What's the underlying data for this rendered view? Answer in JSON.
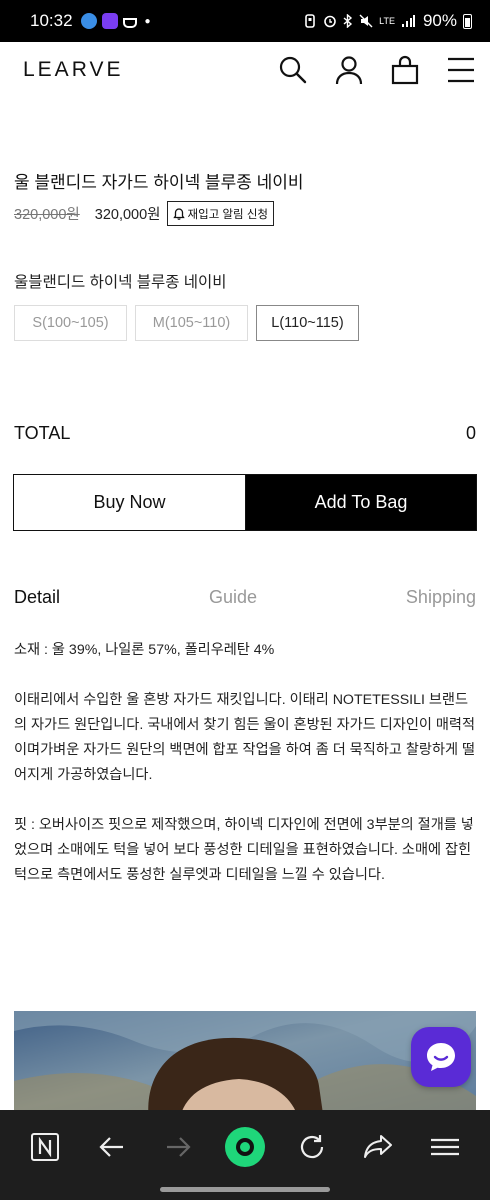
{
  "status_bar": {
    "time": "10:32",
    "network": "LTE",
    "battery": "90%"
  },
  "header": {
    "logo": "LEARVE",
    "icons": [
      "search-icon",
      "user-icon",
      "bag-icon",
      "menu-icon"
    ]
  },
  "product": {
    "title": "울 블랜디드 자가드 하이넥 블루종 네이비",
    "original_price": "320,000원",
    "price": "320,000원",
    "restock_label": "재입고 알림 신청",
    "option_label": "울블랜디드 하이넥 블루종 네이비",
    "sizes": [
      {
        "label": "S(100~105)",
        "selected": false
      },
      {
        "label": "M(105~110)",
        "selected": false
      },
      {
        "label": "L(110~115)",
        "selected": true
      }
    ]
  },
  "total": {
    "label": "TOTAL",
    "value": "0"
  },
  "actions": {
    "buy_now": "Buy Now",
    "add_to_bag": "Add To Bag"
  },
  "tabs": [
    {
      "label": "Detail",
      "active": true
    },
    {
      "label": "Guide",
      "active": false
    },
    {
      "label": "Shipping",
      "active": false
    }
  ],
  "detail": {
    "material": "소재 : 울 39%, 나일론 57%, 폴리우레탄 4%",
    "description": "이태리에서 수입한 울 혼방 자가드 재킷입니다. 이태리 NOTETESSILI 브랜드의 자가드 원단입니다. 국내에서 찾기 힘든 울이 혼방된 자가드 디자인이 매력적이며가벼운 자가드 원단의 백면에 합포 작업을 하여 좀 더 묵직하고 찰랑하게 떨어지게 가공하였습니다.",
    "fit": "핏 : 오버사이즈 핏으로 제작했으며, 하이넥 디자인에 전면에 3부분의 절개를 넣었으며 소매에도 턱을 넣어 보다 풍성한 디테일을 표현하였습니다. 소매에 잡힌 턱으로 측면에서도 풍성한 실루엣과 디테일을 느낄 수 있습니다."
  },
  "colors": {
    "chat_button": "#5a2bd6",
    "nav_background": "#1e1e1e",
    "nav_accent": "#1fd67a"
  }
}
